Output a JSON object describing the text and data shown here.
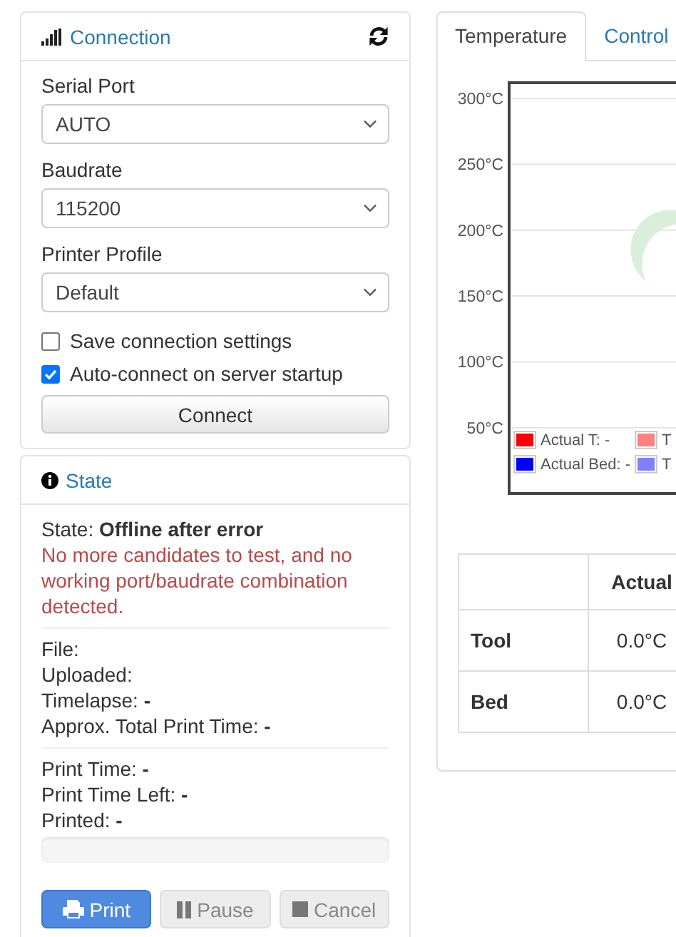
{
  "connection": {
    "title": "Connection",
    "fields": [
      {
        "label": "Serial Port",
        "value": "AUTO"
      },
      {
        "label": "Baudrate",
        "value": "115200"
      },
      {
        "label": "Printer Profile",
        "value": "Default"
      }
    ],
    "options": [
      {
        "label": "Save connection settings",
        "checked": false
      },
      {
        "label": "Auto-connect on server startup",
        "checked": true
      }
    ],
    "button": "Connect"
  },
  "state": {
    "title": "State",
    "status": "State: **Offline after error**",
    "error": "No more candidates to test, and no working port/baudrate combination detected.",
    "groups": [
      [
        "File:",
        "Uploaded:",
        "Timelapse: **-**",
        "Approx. Total Print Time: **-**"
      ],
      [
        "Print Time: **-**",
        "Print Time Left: **-**",
        "Printed: **-**"
      ]
    ],
    "progress": {
      "level": 0
    },
    "buttons": [
      {
        "kind": "print",
        "label": "Print",
        "disabled": false
      },
      {
        "kind": "pause",
        "label": "Pause",
        "disabled": true
      },
      {
        "kind": "cancel",
        "label": "Cancel",
        "disabled": true
      }
    ]
  },
  "tabs": [
    {
      "label": "Temperature",
      "selected": true
    },
    {
      "label": "Control",
      "selected": false
    }
  ],
  "chart_data": {
    "type": "line",
    "ylim": [
      0,
      312
    ],
    "grid": true,
    "yticks": [
      {
        "value": 300,
        "label": "300°C"
      },
      {
        "value": 250,
        "label": "250°C"
      },
      {
        "value": 200,
        "label": "200°C"
      },
      {
        "value": 150,
        "label": "150°C"
      },
      {
        "value": 100,
        "label": "100°C"
      },
      {
        "value": 50,
        "label": "50°C"
      }
    ],
    "series": [
      {
        "name": "Actual T: -",
        "color": "#ff0000"
      },
      {
        "name": "T",
        "color": "#ff8080"
      },
      {
        "name": "Actual Bed: -",
        "color": "#0000ff"
      },
      {
        "name": "T",
        "color": "#8080ff"
      }
    ]
  },
  "table": {
    "columns": [
      "Actual"
    ],
    "rows": [
      {
        "label": "Tool",
        "actual": "0.0°C"
      },
      {
        "label": "Bed",
        "actual": "0.0°C"
      }
    ]
  }
}
